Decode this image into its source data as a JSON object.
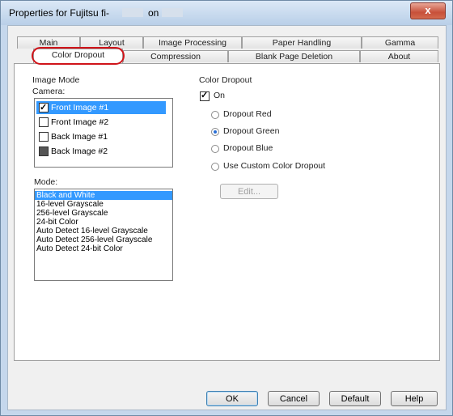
{
  "window": {
    "title_prefix": "Properties for Fujitsu fi-",
    "title_mid": "on",
    "close_label": "x"
  },
  "tabs_row1": [
    {
      "label": "Main"
    },
    {
      "label": "Layout"
    },
    {
      "label": "Image Processing"
    },
    {
      "label": "Paper Handling"
    },
    {
      "label": "Gamma"
    }
  ],
  "tabs_row2": [
    {
      "label": "Color Dropout"
    },
    {
      "label": "Compression"
    },
    {
      "label": "Blank Page Deletion"
    },
    {
      "label": "About"
    }
  ],
  "image_mode": {
    "group_label": "Image Mode",
    "camera_label": "Camera:",
    "camera_items": [
      {
        "label": "Front Image #1",
        "state": "checked",
        "selected": true
      },
      {
        "label": "Front Image #2",
        "state": "unchecked",
        "selected": false
      },
      {
        "label": "Back Image #1",
        "state": "unchecked",
        "selected": false
      },
      {
        "label": "Back Image #2",
        "state": "indeterminate",
        "selected": false
      }
    ],
    "mode_label": "Mode:",
    "mode_items": [
      {
        "label": "Black and White",
        "selected": true
      },
      {
        "label": "16-level Grayscale"
      },
      {
        "label": "256-level Grayscale"
      },
      {
        "label": "24-bit Color"
      },
      {
        "label": "Auto Detect 16-level Grayscale"
      },
      {
        "label": "Auto Detect 256-level Grayscale"
      },
      {
        "label": "Auto Detect 24-bit Color"
      }
    ]
  },
  "color_dropout": {
    "group_label": "Color Dropout",
    "on_label": "On",
    "on_checked": true,
    "options": [
      {
        "label": "Dropout Red",
        "checked": false
      },
      {
        "label": "Dropout Green",
        "checked": true
      },
      {
        "label": "Dropout Blue",
        "checked": false
      },
      {
        "label": "Use Custom Color Dropout",
        "checked": false
      }
    ],
    "edit_label": "Edit..."
  },
  "buttons": {
    "ok": "OK",
    "cancel": "Cancel",
    "default": "Default",
    "help": "Help"
  }
}
